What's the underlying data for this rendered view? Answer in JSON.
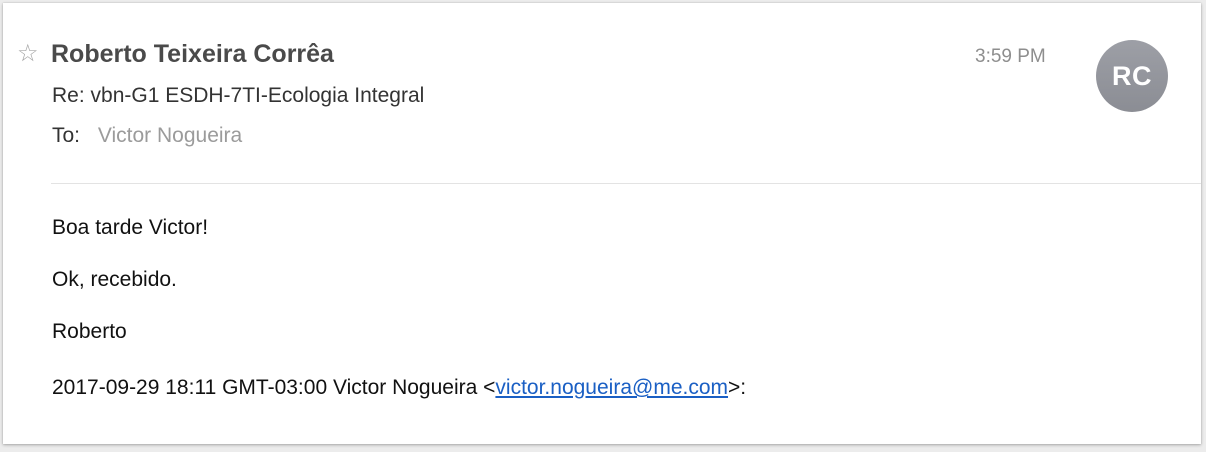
{
  "message": {
    "sender_name": "Roberto Teixeira Corrêa",
    "subject": "Re: vbn-G1 ESDH-7TI-Ecologia Integral",
    "to_label": "To:",
    "to_name": "Victor Nogueira",
    "time": "3:59 PM",
    "avatar_initials": "RC",
    "star_icon": "star-outline-icon"
  },
  "body": {
    "greeting": "Boa tarde Victor!",
    "line2": "Ok, recebido.",
    "signature": "Roberto",
    "quote_prefix": "2017-09-29 18:11 GMT-03:00 Victor Nogueira <",
    "quote_email": "victor.nogueira@me.com",
    "quote_suffix": ">:"
  },
  "colors": {
    "link": "#1a5fc4",
    "avatar_bg": "#8e9097",
    "muted_text": "#9b9b9b"
  }
}
